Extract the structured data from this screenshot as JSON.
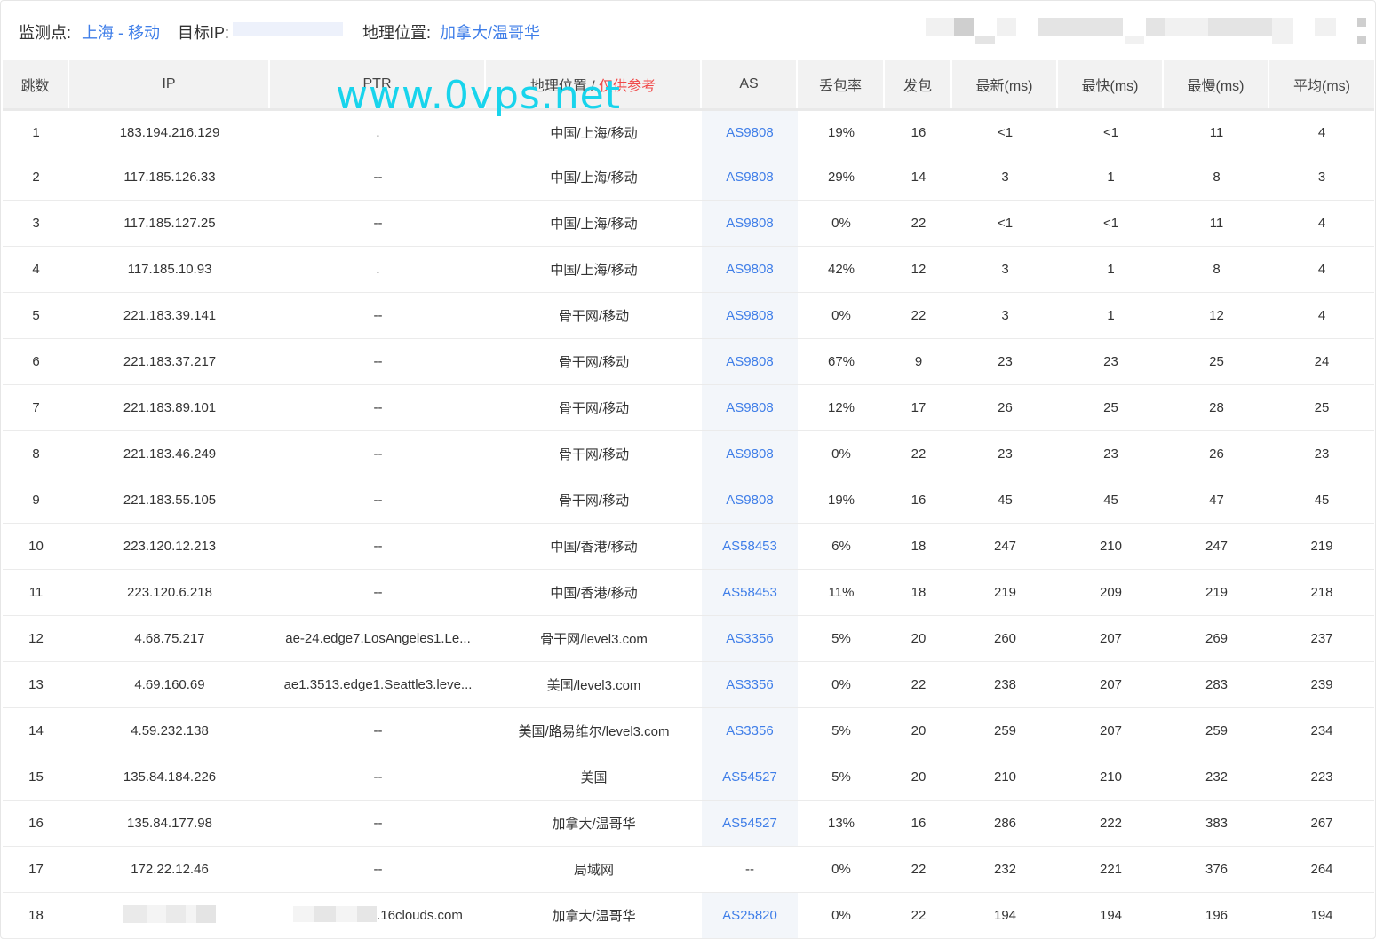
{
  "header": {
    "monitor_label": "监测点:",
    "monitor_value": "上海 - 移动",
    "target_ip_label": "目标IP:",
    "geo_label": "地理位置:",
    "geo_value": "加拿大/温哥华"
  },
  "watermark": "www.0vps.net",
  "table": {
    "columns": {
      "hop": "跳数",
      "ip": "IP",
      "ptr": "PTR",
      "geo": "地理位置",
      "geo_sep": " / ",
      "geo_note": "仅供参考",
      "as": "AS",
      "loss": "丢包率",
      "sent": "发包",
      "last": "最新(ms)",
      "best": "最快(ms)",
      "worst": "最慢(ms)",
      "avg": "平均(ms)"
    },
    "rows": [
      {
        "hop": "1",
        "ip": "183.194.216.129",
        "ptr": ".",
        "geo": "中国/上海/移动",
        "as": "AS9808",
        "loss": "19%",
        "sent": "16",
        "last": "<1",
        "best": "<1",
        "worst": "11",
        "avg": "4"
      },
      {
        "hop": "2",
        "ip": "117.185.126.33",
        "ptr": "--",
        "geo": "中国/上海/移动",
        "as": "AS9808",
        "loss": "29%",
        "sent": "14",
        "last": "3",
        "best": "1",
        "worst": "8",
        "avg": "3"
      },
      {
        "hop": "3",
        "ip": "117.185.127.25",
        "ptr": "--",
        "geo": "中国/上海/移动",
        "as": "AS9808",
        "loss": "0%",
        "sent": "22",
        "last": "<1",
        "best": "<1",
        "worst": "11",
        "avg": "4"
      },
      {
        "hop": "4",
        "ip": "117.185.10.93",
        "ptr": ".",
        "geo": "中国/上海/移动",
        "as": "AS9808",
        "loss": "42%",
        "sent": "12",
        "last": "3",
        "best": "1",
        "worst": "8",
        "avg": "4"
      },
      {
        "hop": "5",
        "ip": "221.183.39.141",
        "ptr": "--",
        "geo": "骨干网/移动",
        "as": "AS9808",
        "loss": "0%",
        "sent": "22",
        "last": "3",
        "best": "1",
        "worst": "12",
        "avg": "4"
      },
      {
        "hop": "6",
        "ip": "221.183.37.217",
        "ptr": "--",
        "geo": "骨干网/移动",
        "as": "AS9808",
        "loss": "67%",
        "sent": "9",
        "last": "23",
        "best": "23",
        "worst": "25",
        "avg": "24"
      },
      {
        "hop": "7",
        "ip": "221.183.89.101",
        "ptr": "--",
        "geo": "骨干网/移动",
        "as": "AS9808",
        "loss": "12%",
        "sent": "17",
        "last": "26",
        "best": "25",
        "worst": "28",
        "avg": "25"
      },
      {
        "hop": "8",
        "ip": "221.183.46.249",
        "ptr": "--",
        "geo": "骨干网/移动",
        "as": "AS9808",
        "loss": "0%",
        "sent": "22",
        "last": "23",
        "best": "23",
        "worst": "26",
        "avg": "23"
      },
      {
        "hop": "9",
        "ip": "221.183.55.105",
        "ptr": "--",
        "geo": "骨干网/移动",
        "as": "AS9808",
        "loss": "19%",
        "sent": "16",
        "last": "45",
        "best": "45",
        "worst": "47",
        "avg": "45"
      },
      {
        "hop": "10",
        "ip": "223.120.12.213",
        "ptr": "--",
        "geo": "中国/香港/移动",
        "as": "AS58453",
        "loss": "6%",
        "sent": "18",
        "last": "247",
        "best": "210",
        "worst": "247",
        "avg": "219"
      },
      {
        "hop": "11",
        "ip": "223.120.6.218",
        "ptr": "--",
        "geo": "中国/香港/移动",
        "as": "AS58453",
        "loss": "11%",
        "sent": "18",
        "last": "219",
        "best": "209",
        "worst": "219",
        "avg": "218"
      },
      {
        "hop": "12",
        "ip": "4.68.75.217",
        "ptr": "ae-24.edge7.LosAngeles1.Le...",
        "geo": "骨干网/level3.com",
        "as": "AS3356",
        "loss": "5%",
        "sent": "20",
        "last": "260",
        "best": "207",
        "worst": "269",
        "avg": "237"
      },
      {
        "hop": "13",
        "ip": "4.69.160.69",
        "ptr": "ae1.3513.edge1.Seattle3.leve...",
        "geo": "美国/level3.com",
        "as": "AS3356",
        "loss": "0%",
        "sent": "22",
        "last": "238",
        "best": "207",
        "worst": "283",
        "avg": "239"
      },
      {
        "hop": "14",
        "ip": "4.59.232.138",
        "ptr": "--",
        "geo": "美国/路易维尔/level3.com",
        "as": "AS3356",
        "loss": "5%",
        "sent": "20",
        "last": "259",
        "best": "207",
        "worst": "259",
        "avg": "234"
      },
      {
        "hop": "15",
        "ip": "135.84.184.226",
        "ptr": "--",
        "geo": "美国",
        "as": "AS54527",
        "loss": "5%",
        "sent": "20",
        "last": "210",
        "best": "210",
        "worst": "232",
        "avg": "223"
      },
      {
        "hop": "16",
        "ip": "135.84.177.98",
        "ptr": "--",
        "geo": "加拿大/温哥华",
        "as": "AS54527",
        "loss": "13%",
        "sent": "16",
        "last": "286",
        "best": "222",
        "worst": "383",
        "avg": "267"
      },
      {
        "hop": "17",
        "ip": "172.22.12.46",
        "ptr": "--",
        "geo": "局域网",
        "as": "--",
        "loss": "0%",
        "sent": "22",
        "last": "232",
        "best": "221",
        "worst": "376",
        "avg": "264"
      },
      {
        "hop": "18",
        "ip": "",
        "ptr": ".16clouds.com",
        "geo": "加拿大/温哥华",
        "as": "AS25820",
        "loss": "0%",
        "sent": "22",
        "last": "194",
        "best": "194",
        "worst": "196",
        "avg": "194"
      }
    ]
  }
}
